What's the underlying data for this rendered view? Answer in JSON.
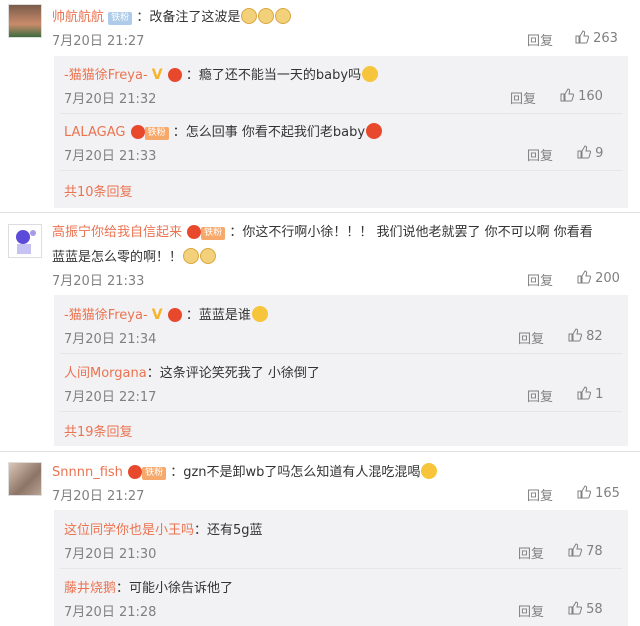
{
  "c1": {
    "user": "帅航航航",
    "badge": "铁粉",
    "text": "：改备注了这波是",
    "time": "7月20日 21:27",
    "reply": "回复",
    "likes": "263",
    "replies": [
      {
        "user": "-猫猫徐Freya-",
        "text": "：瘾了还不能当一天的baby吗",
        "time": "7月20日 21:32",
        "reply": "回复",
        "likes": "160"
      },
      {
        "user": "LALAGAG",
        "text": "：怎么回事 你看不起我们老baby",
        "time": "7月20日 21:33",
        "reply": "回复",
        "likes": "9"
      }
    ],
    "more": "共10条回复"
  },
  "c2": {
    "user": "高振宁你给我自信起来",
    "text": "：你这不行啊小徐！！！ 我们说他老就罢了 你不可以啊 你看看",
    "text2": "蓝蓝是怎么零的啊！！",
    "time": "7月20日 21:33",
    "reply": "回复",
    "likes": "200",
    "replies": [
      {
        "user": "-猫猫徐Freya-",
        "text": "：蓝蓝是谁",
        "time": "7月20日 21:34",
        "reply": "回复",
        "likes": "82"
      },
      {
        "user": "人间Morgana",
        "text": "：这条评论笑死我了 小徐倒了",
        "time": "7月20日 22:17",
        "reply": "回复",
        "likes": "1"
      }
    ],
    "more": "共19条回复"
  },
  "c3": {
    "user": "Snnnn_fish",
    "text": "：gzn不是卸wb了吗怎么知道有人混吃混喝",
    "time": "7月20日 21:27",
    "reply": "回复",
    "likes": "165",
    "replies": [
      {
        "user": "这位同学你也是小王吗",
        "text": "：还有5g蓝",
        "time": "7月20日 21:30",
        "reply": "回复",
        "likes": "78"
      },
      {
        "user": "藤井烧鹅",
        "text": "：可能小徐告诉他了",
        "time": "7月20日 21:28",
        "reply": "回复",
        "likes": "58"
      }
    ]
  },
  "badges": {
    "tie": "铁粉"
  },
  "colors": {
    "username": "#eb7350",
    "reply_bg": "#f2f2f5",
    "meta": "#808080"
  }
}
